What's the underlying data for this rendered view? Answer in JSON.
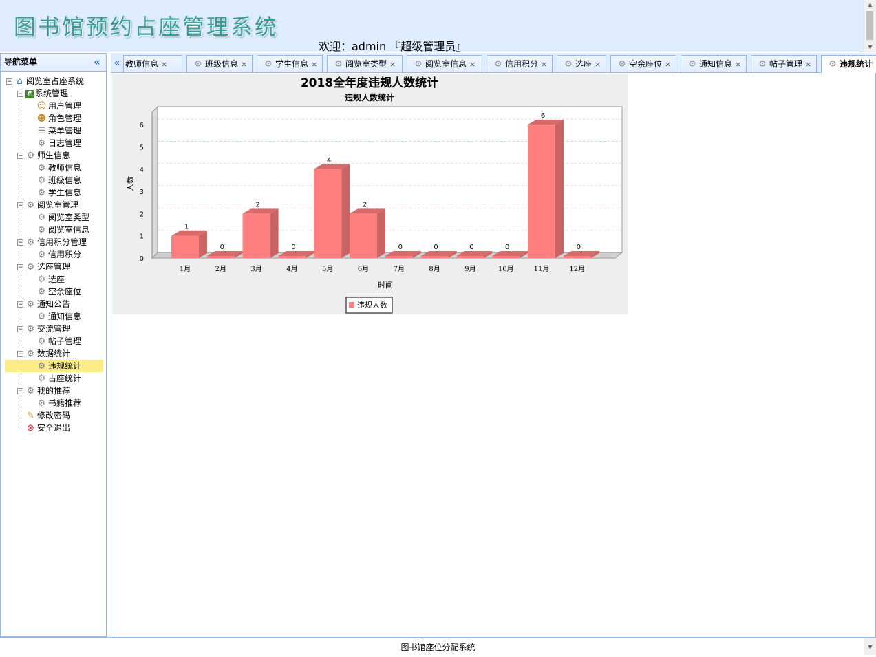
{
  "header": {
    "system_title": "图书馆预约占座管理系统",
    "welcome": "欢迎：admin 『超级管理员』"
  },
  "sidebar": {
    "title": "导航菜单",
    "collapse_icon": "double-chevron-left-icon",
    "root": "阅览室占座系统",
    "groups": [
      {
        "label": "系统管理",
        "icon": "hash-icon",
        "items": [
          {
            "label": "用户管理",
            "icon": "user-icon"
          },
          {
            "label": "角色管理",
            "icon": "users-icon"
          },
          {
            "label": "菜单管理",
            "icon": "menu-icon"
          },
          {
            "label": "日志管理",
            "icon": "gear-icon"
          }
        ]
      },
      {
        "label": "师生信息",
        "icon": "gear-icon",
        "items": [
          {
            "label": "教师信息",
            "icon": "gear-icon"
          },
          {
            "label": "班级信息",
            "icon": "gear-icon"
          },
          {
            "label": "学生信息",
            "icon": "gear-icon"
          }
        ]
      },
      {
        "label": "阅览室管理",
        "icon": "gear-icon",
        "items": [
          {
            "label": "阅览室类型",
            "icon": "gear-icon"
          },
          {
            "label": "阅览室信息",
            "icon": "gear-icon"
          }
        ]
      },
      {
        "label": "信用积分管理",
        "icon": "gear-icon",
        "items": [
          {
            "label": "信用积分",
            "icon": "gear-icon"
          }
        ]
      },
      {
        "label": "选座管理",
        "icon": "gear-icon",
        "items": [
          {
            "label": "选座",
            "icon": "gear-icon"
          },
          {
            "label": "空余座位",
            "icon": "gear-icon"
          }
        ]
      },
      {
        "label": "通知公告",
        "icon": "gear-icon",
        "items": [
          {
            "label": "通知信息",
            "icon": "gear-icon"
          }
        ]
      },
      {
        "label": "交流管理",
        "icon": "gear-icon",
        "items": [
          {
            "label": "帖子管理",
            "icon": "gear-icon"
          }
        ]
      },
      {
        "label": "数据统计",
        "icon": "gear-icon",
        "items": [
          {
            "label": "违规统计",
            "icon": "gear-icon",
            "selected": true
          },
          {
            "label": "占座统计",
            "icon": "gear-icon"
          }
        ]
      },
      {
        "label": "我的推荐",
        "icon": "gear-icon",
        "items": [
          {
            "label": "书籍推荐",
            "icon": "gear-icon"
          }
        ]
      }
    ],
    "extra": [
      {
        "label": "修改密码",
        "icon": "key-icon"
      },
      {
        "label": "安全退出",
        "icon": "exit-icon"
      }
    ]
  },
  "tabs": [
    {
      "label": "教师信息"
    },
    {
      "label": "班级信息"
    },
    {
      "label": "学生信息"
    },
    {
      "label": "阅览室类型"
    },
    {
      "label": "阅览室信息"
    },
    {
      "label": "信用积分"
    },
    {
      "label": "选座"
    },
    {
      "label": "空余座位"
    },
    {
      "label": "通知信息"
    },
    {
      "label": "帖子管理"
    },
    {
      "label": "违规统计",
      "active": true
    }
  ],
  "chart_data": {
    "type": "bar",
    "title": "2018全年度违规人数统计",
    "subtitle": "违规人数统计",
    "xlabel": "时间",
    "ylabel": "人数",
    "categories": [
      "1月",
      "2月",
      "3月",
      "4月",
      "5月",
      "6月",
      "7月",
      "8月",
      "9月",
      "10月",
      "11月",
      "12月"
    ],
    "series": [
      {
        "name": "违规人数",
        "values": [
          1,
          0,
          2,
          0,
          4,
          2,
          0,
          0,
          0,
          0,
          6,
          0
        ],
        "color": "#ff7f7f"
      }
    ],
    "ylim": [
      0,
      6.5
    ],
    "yticks": [
      0,
      1,
      2,
      3,
      4,
      5,
      6
    ],
    "grid": true,
    "legend": "bottom"
  },
  "footer": {
    "text": "图书馆座位分配系统"
  }
}
